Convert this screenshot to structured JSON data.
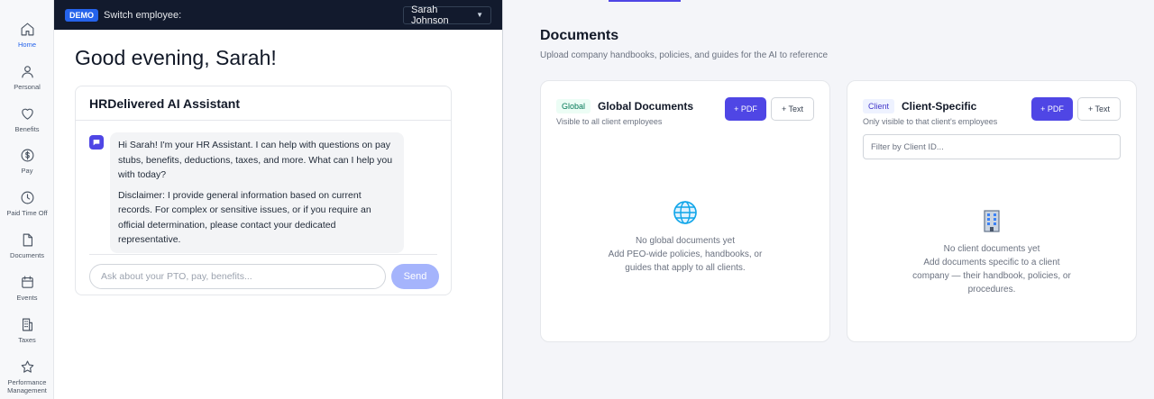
{
  "sidebar": {
    "items": [
      {
        "label": "Home",
        "icon": "home-icon",
        "active": true
      },
      {
        "label": "Personal",
        "icon": "person-icon"
      },
      {
        "label": "Benefits",
        "icon": "heart-icon"
      },
      {
        "label": "Pay",
        "icon": "dollar-icon"
      },
      {
        "label": "Paid Time Off",
        "icon": "clock-icon"
      },
      {
        "label": "Documents",
        "icon": "document-icon"
      },
      {
        "label": "Events",
        "icon": "calendar-icon"
      },
      {
        "label": "Taxes",
        "icon": "building-icon"
      },
      {
        "label": "Performance Management",
        "icon": "star-icon"
      }
    ]
  },
  "demo_bar": {
    "badge": "DEMO",
    "switch_label": "Switch employee:",
    "selected_employee": "Sarah Johnson"
  },
  "greeting": "Good evening, Sarah!",
  "chat": {
    "title": "HRDelivered AI Assistant",
    "message_intro": "Hi Sarah! I'm your HR Assistant. I can help with questions on pay stubs, benefits, deductions, taxes, and more. What can I help you with today?",
    "message_disclaimer": "Disclaimer: I provide general information based on current records. For complex or sensitive issues, or if you require an official determination, please contact your dedicated representative.",
    "input_placeholder": "Ask about your PTO, pay, benefits...",
    "send_label": "Send"
  },
  "documents": {
    "title": "Documents",
    "subtitle": "Upload company handbooks, policies, and guides for the AI to reference",
    "global": {
      "badge": "Global",
      "title": "Global Documents",
      "subtitle": "Visible to all client employees",
      "pdf_label": "+ PDF",
      "text_label": "+ Text",
      "empty_title": "No global documents yet",
      "empty_desc": "Add PEO-wide policies, handbooks, or guides that apply to all clients."
    },
    "client": {
      "badge": "Client",
      "title": "Client-Specific",
      "subtitle": "Only visible to that client's employees",
      "pdf_label": "+ PDF",
      "text_label": "+ Text",
      "filter_placeholder": "Filter by Client ID...",
      "empty_title": "No client documents yet",
      "empty_desc": "Add documents specific to a client company — their handbook, policies, or procedures."
    }
  },
  "colors": {
    "accent": "#4f46e5",
    "demo_bar": "#121a2d",
    "send_disabled": "#a5b4fc"
  }
}
